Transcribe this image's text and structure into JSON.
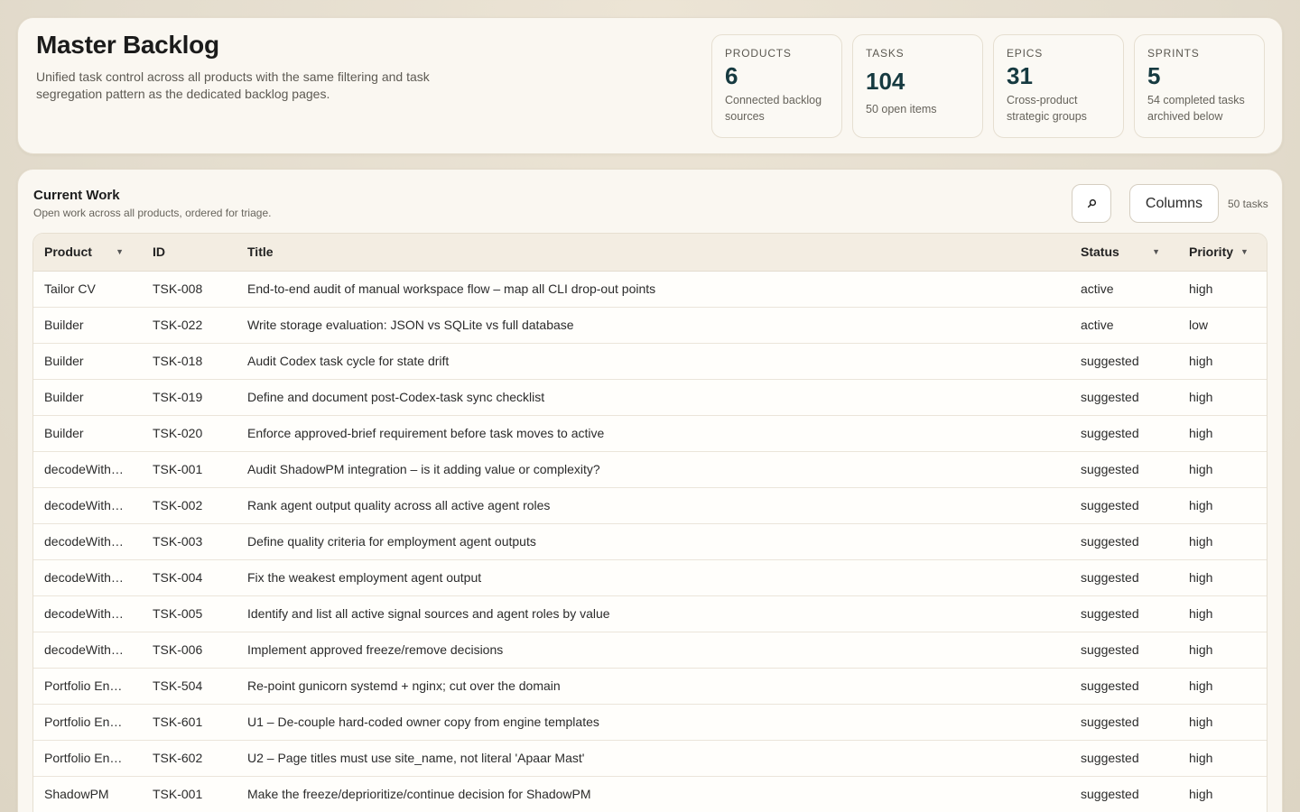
{
  "header": {
    "title": "Master Backlog",
    "subtitle": "Unified task control across all products with the same filtering and task segregation pattern as the dedicated backlog pages."
  },
  "stats": [
    {
      "label": "PRODUCTS",
      "value": "6",
      "note": "Connected backlog sources"
    },
    {
      "label": "TASKS",
      "value": "104",
      "note": "50 open items"
    },
    {
      "label": "EPICS",
      "value": "31",
      "note": "Cross-product strategic groups"
    },
    {
      "label": "SPRINTS",
      "value": "5",
      "note": "54 completed tasks archived below"
    }
  ],
  "current_work": {
    "title": "Current Work",
    "subtitle": "Open work across all products, ordered for triage.",
    "columns_label": "Columns",
    "task_count": "50 tasks",
    "icons": {
      "search": "search-icon",
      "sort": "caret-down-icon"
    }
  },
  "table": {
    "headers": {
      "product": "Product",
      "id": "ID",
      "title": "Title",
      "status": "Status",
      "priority": "Priority"
    },
    "rows": [
      {
        "product": "Tailor CV",
        "id": "TSK-008",
        "title": "End-to-end audit of manual workspace flow – map all CLI drop-out points",
        "status": "active",
        "priority": "high"
      },
      {
        "product": "Builder",
        "id": "TSK-022",
        "title": "Write storage evaluation: JSON vs SQLite vs full database",
        "status": "active",
        "priority": "low"
      },
      {
        "product": "Builder",
        "id": "TSK-018",
        "title": "Audit Codex task cycle for state drift",
        "status": "suggested",
        "priority": "high"
      },
      {
        "product": "Builder",
        "id": "TSK-019",
        "title": "Define and document post-Codex-task sync checklist",
        "status": "suggested",
        "priority": "high"
      },
      {
        "product": "Builder",
        "id": "TSK-020",
        "title": "Enforce approved-brief requirement before task moves to active",
        "status": "suggested",
        "priority": "high"
      },
      {
        "product": "decodeWith…",
        "id": "TSK-001",
        "title": "Audit ShadowPM integration – is it adding value or complexity?",
        "status": "suggested",
        "priority": "high"
      },
      {
        "product": "decodeWith…",
        "id": "TSK-002",
        "title": "Rank agent output quality across all active agent roles",
        "status": "suggested",
        "priority": "high"
      },
      {
        "product": "decodeWith…",
        "id": "TSK-003",
        "title": "Define quality criteria for employment agent outputs",
        "status": "suggested",
        "priority": "high"
      },
      {
        "product": "decodeWith…",
        "id": "TSK-004",
        "title": "Fix the weakest employment agent output",
        "status": "suggested",
        "priority": "high"
      },
      {
        "product": "decodeWith…",
        "id": "TSK-005",
        "title": "Identify and list all active signal sources and agent roles by value",
        "status": "suggested",
        "priority": "high"
      },
      {
        "product": "decodeWith…",
        "id": "TSK-006",
        "title": "Implement approved freeze/remove decisions",
        "status": "suggested",
        "priority": "high"
      },
      {
        "product": "Portfolio En…",
        "id": "TSK-504",
        "title": "Re-point gunicorn systemd + nginx; cut over the domain",
        "status": "suggested",
        "priority": "high"
      },
      {
        "product": "Portfolio En…",
        "id": "TSK-601",
        "title": "U1 – De-couple hard-coded owner copy from engine templates",
        "status": "suggested",
        "priority": "high"
      },
      {
        "product": "Portfolio En…",
        "id": "TSK-602",
        "title": "U2 – Page titles must use site_name, not literal 'Apaar Mast'",
        "status": "suggested",
        "priority": "high"
      },
      {
        "product": "ShadowPM",
        "id": "TSK-001",
        "title": "Make the freeze/deprioritize/continue decision for ShadowPM",
        "status": "suggested",
        "priority": "high"
      }
    ]
  }
}
